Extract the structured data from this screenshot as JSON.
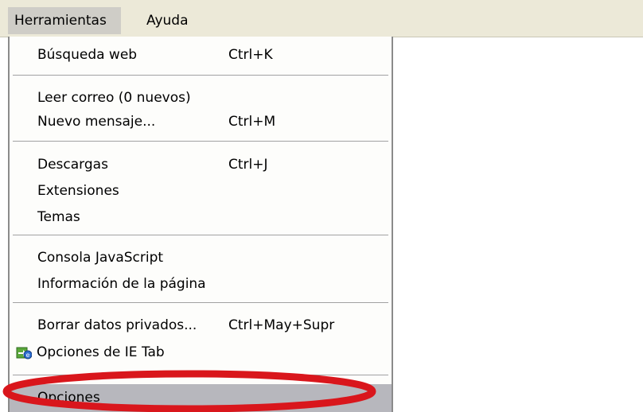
{
  "menubar": {
    "tools_label": "Herramientas",
    "help_label": "Ayuda"
  },
  "menu": {
    "web_search": {
      "label": "Búsqueda web",
      "shortcut": "Ctrl+K"
    },
    "read_mail": {
      "label": "Leer correo (0 nuevos)"
    },
    "new_message": {
      "label": "Nuevo mensaje...",
      "shortcut": "Ctrl+M"
    },
    "downloads": {
      "label": "Descargas",
      "shortcut": "Ctrl+J"
    },
    "extensions": {
      "label": "Extensiones"
    },
    "themes": {
      "label": "Temas"
    },
    "js_console": {
      "label": "Consola JavaScript"
    },
    "page_info": {
      "label": "Información de la página"
    },
    "clear_private": {
      "label": "Borrar datos privados...",
      "shortcut": "Ctrl+May+Supr"
    },
    "ie_tab_options": {
      "label": "Opciones de IE Tab",
      "icon": "ie-tab-icon"
    },
    "options": {
      "label": "Opciones"
    }
  },
  "colors": {
    "menubar_bg": "#ece9d8",
    "highlight": "#b7b7bd",
    "annotation_ellipse": "#d9161c"
  }
}
